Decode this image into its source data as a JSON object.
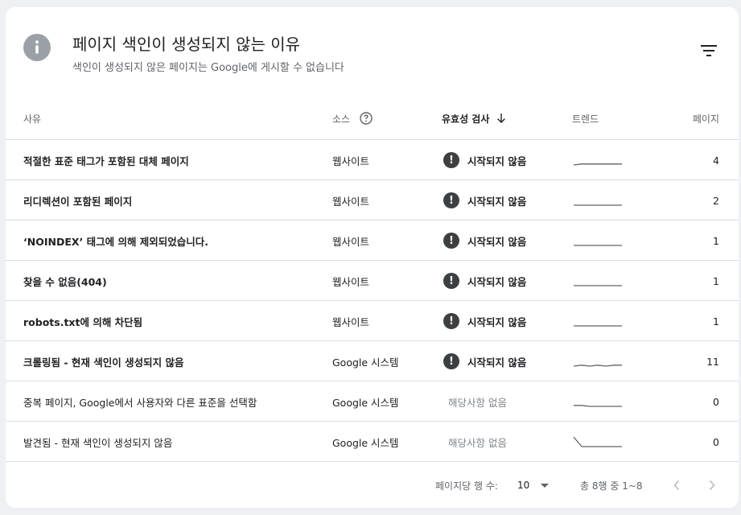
{
  "header": {
    "title": "페이지 색인이 생성되지 않는 이유",
    "subtitle": "색인이 생성되지 않은 페이지는 Google에 게시할 수 없습니다"
  },
  "columns": {
    "reason": "사유",
    "source": "소스",
    "validation": "유효성 검사",
    "trend": "트렌드",
    "pages": "페이지"
  },
  "rows": [
    {
      "reason": "적절한 표준 태그가 포함된 대체 페이지",
      "source": "웹사이트",
      "validation": "시작되지 않음",
      "pages": "4",
      "trend_values": [
        1,
        2,
        2,
        2,
        2,
        2,
        2
      ]
    },
    {
      "reason": "리디렉션이 포함된 페이지",
      "source": "웹사이트",
      "validation": "시작되지 않음",
      "pages": "2",
      "trend_values": [
        1,
        1,
        1,
        1,
        1,
        1,
        1
      ]
    },
    {
      "reason": "‘NOINDEX’ 태그에 의해 제외되었습니다.",
      "source": "웹사이트",
      "validation": "시작되지 않음",
      "pages": "1",
      "trend_values": [
        1,
        1,
        1,
        1,
        1,
        1,
        1
      ]
    },
    {
      "reason": "찾을 수 없음(404)",
      "source": "웹사이트",
      "validation": "시작되지 않음",
      "pages": "1",
      "trend_values": [
        1,
        1,
        1,
        1,
        1,
        1,
        1
      ]
    },
    {
      "reason": "robots.txt에 의해 차단됨",
      "source": "웹사이트",
      "validation": "시작되지 않음",
      "pages": "1",
      "trend_values": [
        1,
        1,
        1,
        1,
        1,
        1,
        1
      ]
    },
    {
      "reason": "크롤링됨 - 현재 색인이 생성되지 않음",
      "source": "Google 시스템",
      "validation": "시작되지 않음",
      "pages": "11",
      "trend_values": [
        10,
        11,
        10,
        11,
        10,
        11,
        11
      ]
    },
    {
      "reason": "중복 페이지, Google에서 사용자와 다른 표준을 선택함",
      "source": "Google 시스템",
      "validation": "해당사항 없음",
      "pages": "0",
      "trend_values": [
        1,
        1,
        0,
        0,
        0,
        0,
        0
      ]
    },
    {
      "reason": "발견됨 - 현재 색인이 생성되지 않음",
      "source": "Google 시스템",
      "validation": "해당사항 없음",
      "pages": "0",
      "trend_values": [
        5,
        0,
        0,
        0,
        0,
        0,
        0
      ]
    }
  ],
  "footer": {
    "rows_per_page_label": "페이지당 행 수:",
    "rows_per_page_value": "10",
    "range_text": "총 8행 중 1~8"
  },
  "colors": {
    "status_icon": "#3c4043",
    "trend_line": "#5f6368",
    "divider": "#dadce0"
  }
}
